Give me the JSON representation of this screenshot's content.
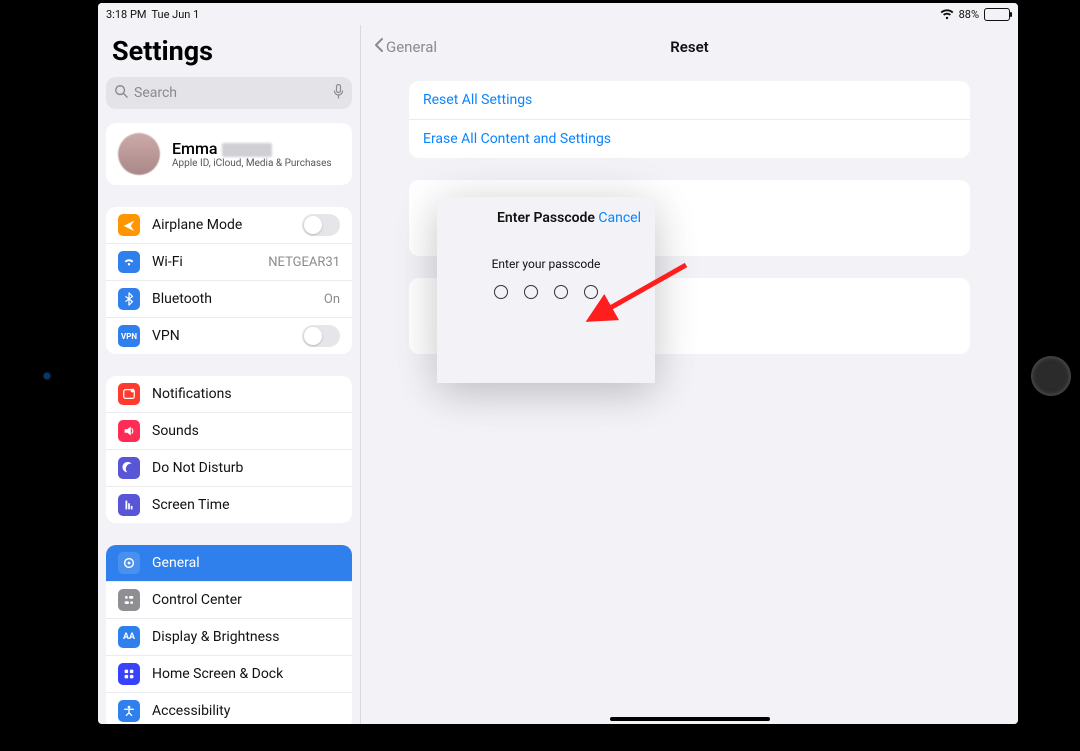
{
  "statusbar": {
    "time": "3:18 PM",
    "date": "Tue Jun 1",
    "battery_percent": "88%",
    "battery_fill": 88
  },
  "sidebar": {
    "title": "Settings",
    "search_placeholder": "Search",
    "profile": {
      "name": "Emma",
      "subtitle": "Apple ID, iCloud, Media & Purchases"
    },
    "group1": [
      {
        "id": "airplane",
        "label": "Airplane Mode",
        "icon": "airplane-icon",
        "color": "#ff9500",
        "toggle": false
      },
      {
        "id": "wifi",
        "label": "Wi-Fi",
        "icon": "wifi-icon",
        "color": "#2f80ed",
        "value": "NETGEAR31"
      },
      {
        "id": "bt",
        "label": "Bluetooth",
        "icon": "bluetooth-icon",
        "color": "#2f80ed",
        "value": "On"
      },
      {
        "id": "vpn",
        "label": "VPN",
        "icon": "vpn-icon",
        "color": "#2f80ed",
        "toggle": false
      }
    ],
    "group2": [
      {
        "id": "notif",
        "label": "Notifications",
        "icon": "notifications-icon",
        "color": "#ff3b30"
      },
      {
        "id": "sounds",
        "label": "Sounds",
        "icon": "sounds-icon",
        "color": "#ff2d55"
      },
      {
        "id": "dnd",
        "label": "Do Not Disturb",
        "icon": "dnd-icon",
        "color": "#5856d6"
      },
      {
        "id": "screen",
        "label": "Screen Time",
        "icon": "screentime-icon",
        "color": "#5856d6"
      }
    ],
    "group3": [
      {
        "id": "general",
        "label": "General",
        "icon": "general-icon",
        "color": "#8e8e93",
        "selected": true
      },
      {
        "id": "cc",
        "label": "Control Center",
        "icon": "controlcenter-icon",
        "color": "#8e8e93"
      },
      {
        "id": "display",
        "label": "Display & Brightness",
        "icon": "display-icon",
        "color": "#2f80ed"
      },
      {
        "id": "home",
        "label": "Home Screen & Dock",
        "icon": "homescreen-icon",
        "color": "#3742fa"
      },
      {
        "id": "a11y",
        "label": "Accessibility",
        "icon": "accessibility-icon",
        "color": "#2f80ed"
      }
    ]
  },
  "detail": {
    "back_label": "General",
    "title": "Reset",
    "group1": [
      {
        "label": "Reset All Settings"
      },
      {
        "label": "Erase All Content and Settings"
      }
    ],
    "group2_rows": 2,
    "group3_rows": 2
  },
  "modal": {
    "title": "Enter Passcode",
    "cancel": "Cancel",
    "prompt": "Enter your passcode",
    "digits": 4
  }
}
